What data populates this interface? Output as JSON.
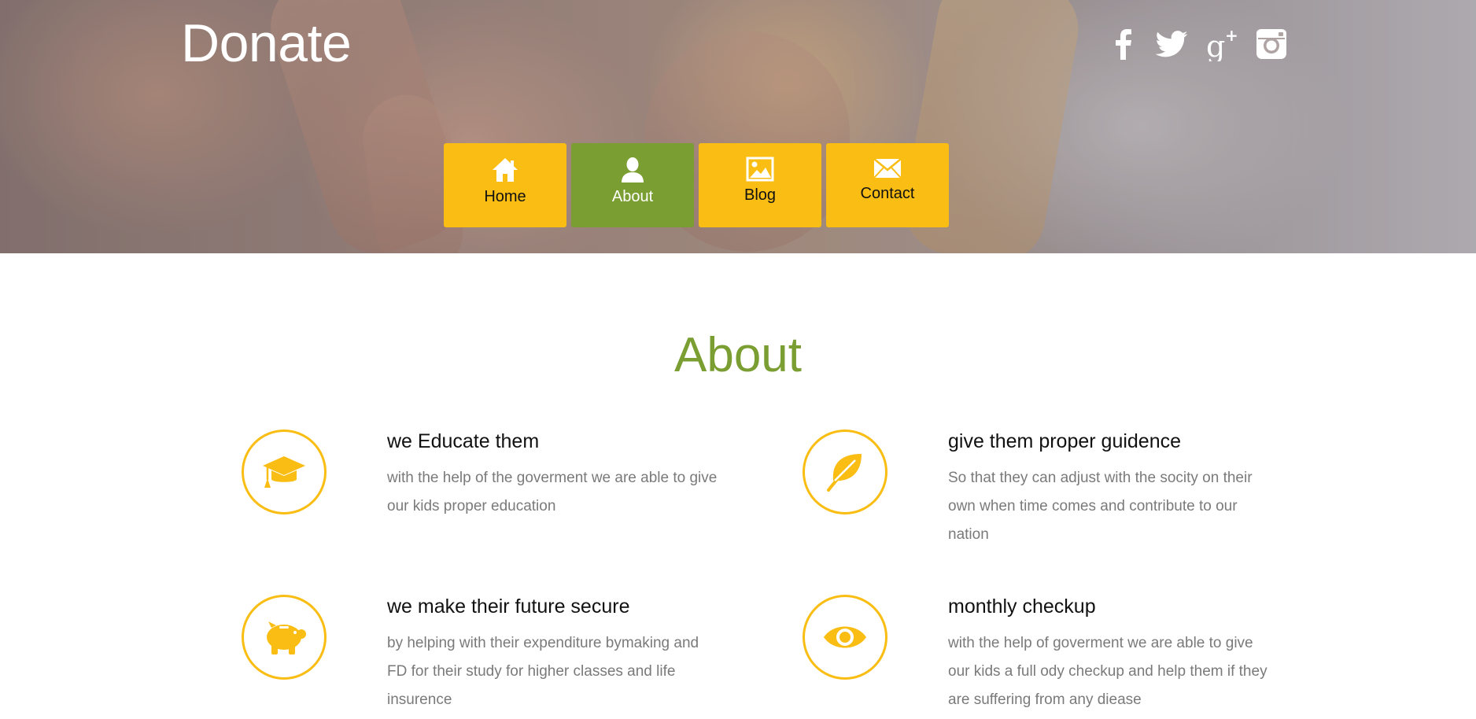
{
  "header": {
    "logo": "Donate",
    "social": [
      "facebook-icon",
      "twitter-icon",
      "google-plus-icon",
      "instagram-icon"
    ]
  },
  "nav": {
    "items": [
      {
        "label": "Home",
        "icon": "home-icon"
      },
      {
        "label": "About",
        "icon": "user-icon",
        "active": true
      },
      {
        "label": "Blog",
        "icon": "image-icon"
      },
      {
        "label": "Contact",
        "icon": "mail-icon"
      }
    ]
  },
  "about": {
    "title": "About",
    "features": [
      {
        "title": "we Educate them",
        "desc": "with the help of the goverment we are able to give our kids proper education",
        "icon": "graduation-cap-icon"
      },
      {
        "title": "give them proper guidence",
        "desc": "So that they can adjust with the socity on their own when time comes and contribute to our nation",
        "icon": "leaf-icon"
      },
      {
        "title": "we make their future secure",
        "desc": "by helping with their expenditure bymaking and FD for their study for higher classes and life insurence",
        "icon": "piggy-bank-icon"
      },
      {
        "title": "monthly checkup",
        "desc": "with the help of goverment we are able to give our kids a full ody checkup and help them if they are suffering from any diease",
        "icon": "eye-icon"
      }
    ]
  },
  "colors": {
    "accent_yellow": "#f9bd13",
    "accent_green": "#7a9e31"
  }
}
